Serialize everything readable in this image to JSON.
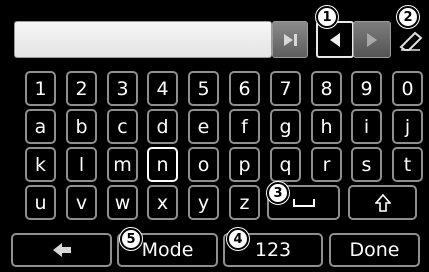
{
  "input": {
    "value": ""
  },
  "rows": [
    [
      "1",
      "2",
      "3",
      "4",
      "5",
      "6",
      "7",
      "8",
      "9",
      "0"
    ],
    [
      "a",
      "b",
      "c",
      "d",
      "e",
      "f",
      "g",
      "h",
      "i",
      "j"
    ],
    [
      "k",
      "l",
      "m",
      "n",
      "o",
      "p",
      "q",
      "r",
      "s",
      "t"
    ],
    [
      "u",
      "v",
      "w",
      "x",
      "y",
      "z"
    ]
  ],
  "selected_key": "n",
  "bottom": {
    "mode_label": "Mode",
    "numeric_label": "123",
    "done_label": "Done"
  },
  "callouts": [
    "1",
    "2",
    "3",
    "4",
    "5"
  ],
  "icons": {
    "end": "skip-to-end-icon",
    "left": "arrow-left-icon",
    "right": "arrow-right-icon",
    "erase": "eraser-icon",
    "space": "space-icon",
    "shift": "shift-icon",
    "back": "back-arrow-icon"
  },
  "colors": {
    "background": "#000000",
    "key_border": "#8f8f8f",
    "selected_border": "#ffffff"
  }
}
